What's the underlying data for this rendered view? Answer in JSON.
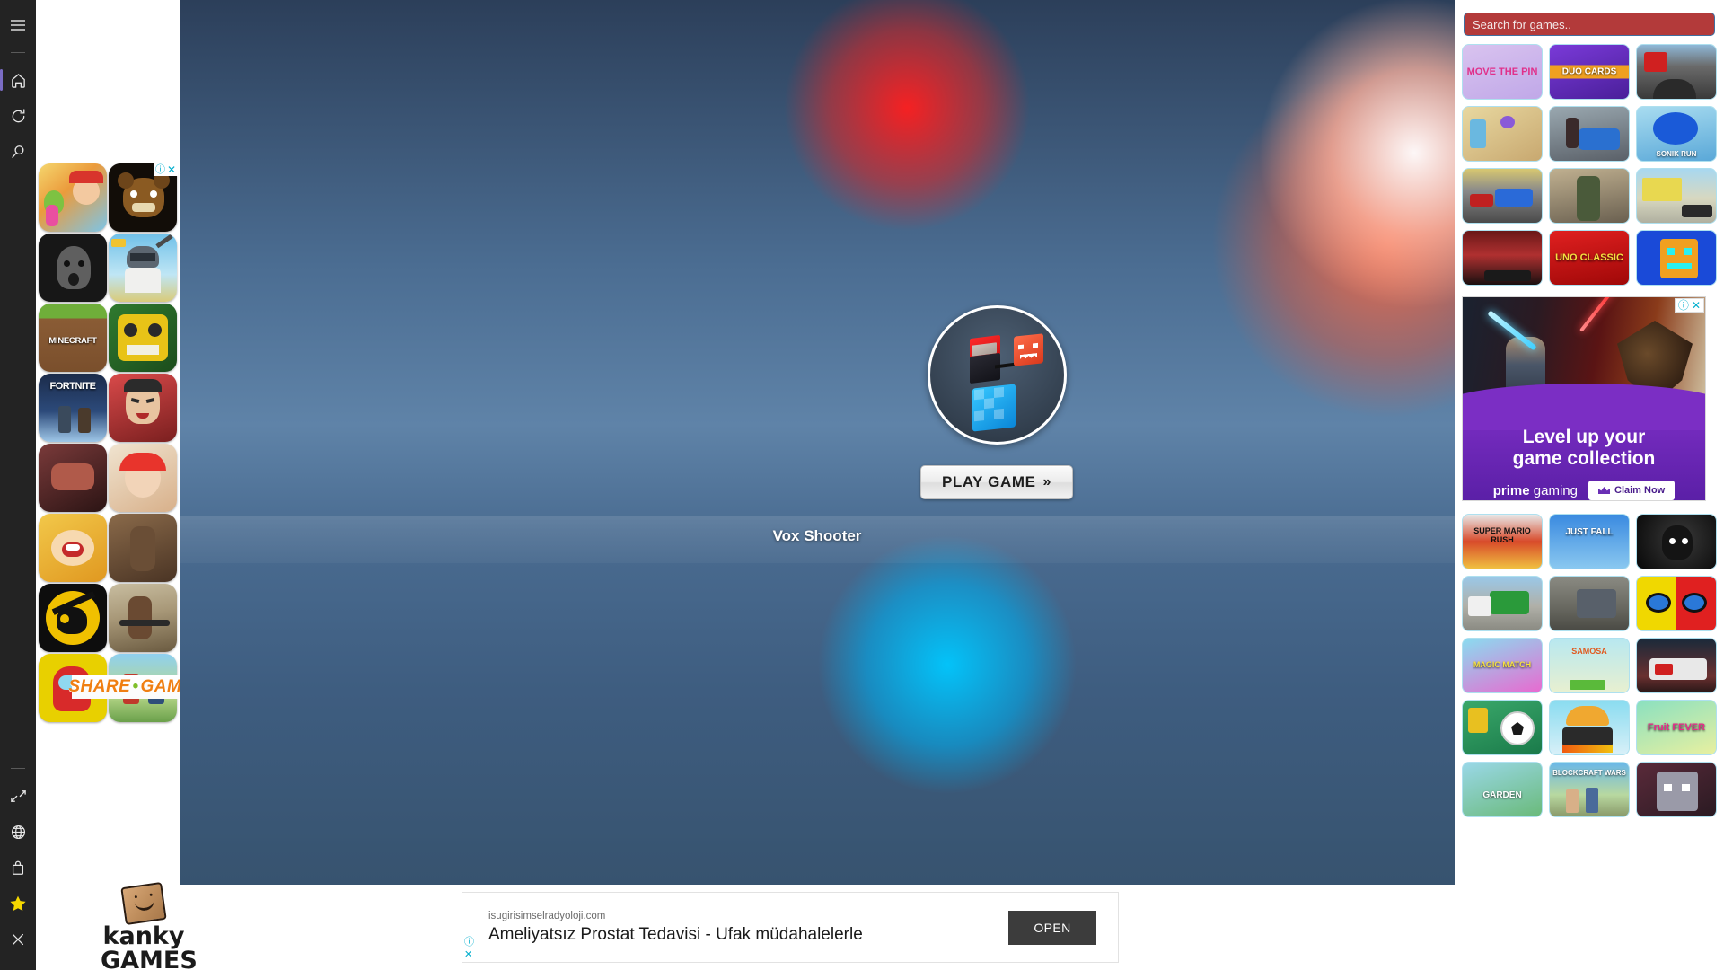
{
  "sidebar": {
    "top_items": [
      {
        "name": "menu-icon",
        "label": "Menu"
      },
      {
        "name": "home-icon",
        "label": "Home"
      },
      {
        "name": "refresh-icon",
        "label": "Refresh"
      },
      {
        "name": "search-icon",
        "label": "Search"
      }
    ],
    "bottom_items": [
      {
        "name": "collapse-icon",
        "label": "Collapse"
      },
      {
        "name": "globe-icon",
        "label": "Globe"
      },
      {
        "name": "bag-icon",
        "label": "Shopping bag"
      },
      {
        "name": "star-icon",
        "label": "Favorites"
      },
      {
        "name": "close-icon",
        "label": "Close"
      }
    ],
    "accent_color": "#7a6cc4",
    "star_color": "#f5d800",
    "background": "#232323"
  },
  "left_ad": {
    "info_icon": "ⓘ",
    "close_icon": "✕",
    "thumbs": [
      {
        "name": "subway-surfers",
        "label": ""
      },
      {
        "name": "five-nights-at-freddys",
        "label": ""
      },
      {
        "name": "granny",
        "label": ""
      },
      {
        "name": "pubg-mobile",
        "label": ""
      },
      {
        "name": "minecraft",
        "label": "MINECRAFT"
      },
      {
        "name": "temple-run",
        "label": ""
      },
      {
        "name": "fortnite",
        "label": "FORTNITE"
      },
      {
        "name": "scary-teacher",
        "label": ""
      },
      {
        "name": "dino-game",
        "label": ""
      },
      {
        "name": "stumble-guys",
        "label": ""
      },
      {
        "name": "mouth-game",
        "label": ""
      },
      {
        "name": "gangster-city",
        "label": ""
      },
      {
        "name": "brawl-stars",
        "label": ""
      },
      {
        "name": "gta-san-andreas",
        "label": ""
      },
      {
        "name": "among-us",
        "label": ""
      },
      {
        "name": "roblox",
        "label": ""
      }
    ],
    "banner": {
      "text_1": "SHARE",
      "dot": "•",
      "text_2": "GAMES"
    }
  },
  "brand": {
    "line1": "kanky",
    "line2": "GAMES"
  },
  "stage": {
    "play_button_label": "PLAY GAME",
    "play_button_chevron": "»",
    "game_title": "Vox Shooter"
  },
  "bottom_ad": {
    "domain": "isugirisimselradyoloji.com",
    "headline": "Ameliyatsız Prostat Tedavisi - Ufak müdahalelerle",
    "button_label": "OPEN",
    "info_icon": "ⓘ",
    "close_icon": "✕"
  },
  "right_panel": {
    "search": {
      "placeholder": "Search for games..",
      "value": "",
      "background": "#b33a3a",
      "border": "#3f6fa0"
    },
    "grid_top": [
      {
        "name": "move-the-pin",
        "label": "MOVE THE PIN"
      },
      {
        "name": "duo-cards",
        "label": "DUO CARDS"
      },
      {
        "name": "bus-driving",
        "label": ""
      },
      {
        "name": "farm-adventure",
        "label": ""
      },
      {
        "name": "city-shooter",
        "label": ""
      },
      {
        "name": "sonik-run",
        "label": "SONIK RUN"
      },
      {
        "name": "monster-truck-race",
        "label": ""
      },
      {
        "name": "commando-strike",
        "label": ""
      },
      {
        "name": "pixel-gun-street",
        "label": ""
      },
      {
        "name": "zombie-sniper",
        "label": ""
      },
      {
        "name": "uno-classic",
        "label": "UNO CLASSIC"
      },
      {
        "name": "geometry-dash",
        "label": ""
      }
    ],
    "ad": {
      "headline_1": "Level up your",
      "headline_2": "game collection",
      "brand_bold": "prime",
      "brand_rest": " gaming",
      "cta_label": "Claim Now",
      "info_icon": "ⓘ",
      "close_icon": "✕",
      "accent_color": "#7b2ec4"
    },
    "grid_bottom": [
      {
        "name": "super-mario-rush",
        "label": "SUPER MARIO RUSH"
      },
      {
        "name": "just-fall-lol",
        "label": "JUST FALL"
      },
      {
        "name": "limbo-shadow",
        "label": ""
      },
      {
        "name": "garbage-truck-sim",
        "label": ""
      },
      {
        "name": "truck-simulator",
        "label": ""
      },
      {
        "name": "among-us-impostor",
        "label": ""
      },
      {
        "name": "magic-match-puzzle",
        "label": "MAGIC MATCH"
      },
      {
        "name": "simple-samosa",
        "label": "SAMOSA"
      },
      {
        "name": "fire-truck-rescue",
        "label": ""
      },
      {
        "name": "soccer-five",
        "label": ""
      },
      {
        "name": "food-truck",
        "label": ""
      },
      {
        "name": "fruit-fever-world",
        "label": "Fruit FEVER"
      },
      {
        "name": "garden-bloom",
        "label": "GARDEN"
      },
      {
        "name": "blockcraft-wars",
        "label": "BLOCKCRAFT WARS"
      },
      {
        "name": "pixel-robot",
        "label": ""
      }
    ]
  }
}
